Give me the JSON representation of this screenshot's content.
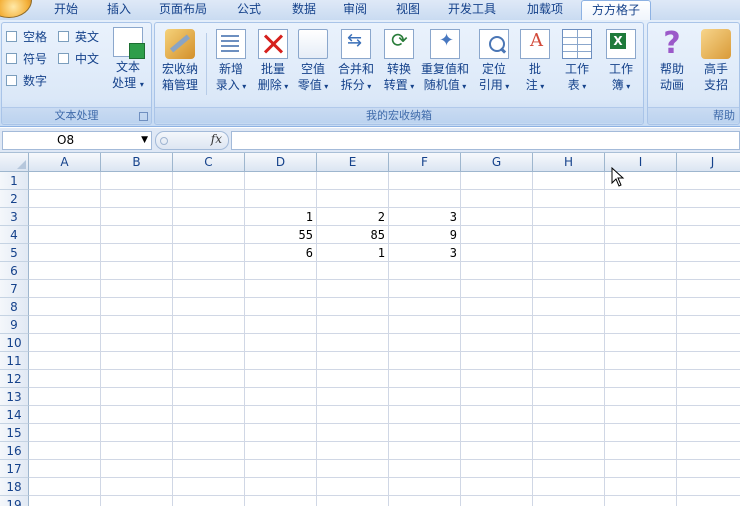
{
  "tabs": [
    "开始",
    "插入",
    "页面布局",
    "公式",
    "数据",
    "审阅",
    "视图",
    "开发工具",
    "加载项",
    "方方格子"
  ],
  "active_tab": "方方格子",
  "text_group": {
    "checkboxes": [
      "空格",
      "英文",
      "符号",
      "中文",
      "数字"
    ],
    "button_line1": "文本",
    "button_line2": "处理",
    "label": "文本处理"
  },
  "macro_group": {
    "label": "我的宏收纳箱",
    "buttons": [
      {
        "line1": "宏收纳",
        "line2": "箱管理",
        "arrow": false,
        "icon": "tools-icon"
      },
      {
        "line1": "新增",
        "line2": "录入",
        "arrow": true,
        "icon": "new-entry-icon"
      },
      {
        "line1": "批量",
        "line2": "删除",
        "arrow": true,
        "icon": "delete-icon"
      },
      {
        "line1": "空值",
        "line2": "零值",
        "arrow": true,
        "icon": "blank-icon"
      },
      {
        "line1": "合并和",
        "line2": "拆分",
        "arrow": true,
        "icon": "merge-icon"
      },
      {
        "line1": "转换",
        "line2": "转置",
        "arrow": true,
        "icon": "convert-icon"
      },
      {
        "line1": "重复值和",
        "line2": "随机值",
        "arrow": true,
        "icon": "duplicate-icon"
      },
      {
        "line1": "定位",
        "line2": "引用",
        "arrow": true,
        "icon": "locate-icon"
      },
      {
        "line1": "批",
        "line2": "注",
        "arrow": true,
        "icon": "comment-icon"
      },
      {
        "line1": "工作",
        "line2": "表",
        "arrow": true,
        "icon": "worksheet-icon"
      },
      {
        "line1": "工作",
        "line2": "簿",
        "arrow": true,
        "icon": "workbook-icon"
      }
    ]
  },
  "help_group": {
    "label": "帮助",
    "buttons": [
      {
        "line1": "帮助",
        "line2": "动画",
        "icon": "help-icon"
      },
      {
        "line1": "高手",
        "line2": "支招",
        "icon": "tips-icon"
      }
    ]
  },
  "formula_bar": {
    "name_box": "O8",
    "fx_label": "fx",
    "formula": ""
  },
  "columns": [
    "A",
    "B",
    "C",
    "D",
    "E",
    "F",
    "G",
    "H",
    "I",
    "J"
  ],
  "rows": [
    "1",
    "2",
    "3",
    "4",
    "5",
    "6",
    "7",
    "8",
    "9",
    "10",
    "11",
    "12",
    "13",
    "14",
    "15",
    "16",
    "17",
    "18",
    "19"
  ],
  "cells": [
    {
      "ref": "D3",
      "value": "1"
    },
    {
      "ref": "E3",
      "value": "2"
    },
    {
      "ref": "F3",
      "value": "3"
    },
    {
      "ref": "D4",
      "value": "55"
    },
    {
      "ref": "E4",
      "value": "85"
    },
    {
      "ref": "F4",
      "value": "9"
    },
    {
      "ref": "D5",
      "value": "6"
    },
    {
      "ref": "E5",
      "value": "1"
    },
    {
      "ref": "F5",
      "value": "3"
    }
  ],
  "colors": {
    "ribbon_text": "#15428b",
    "active_tab_border": "#8db2e3",
    "gridline": "#d0d7e5"
  }
}
